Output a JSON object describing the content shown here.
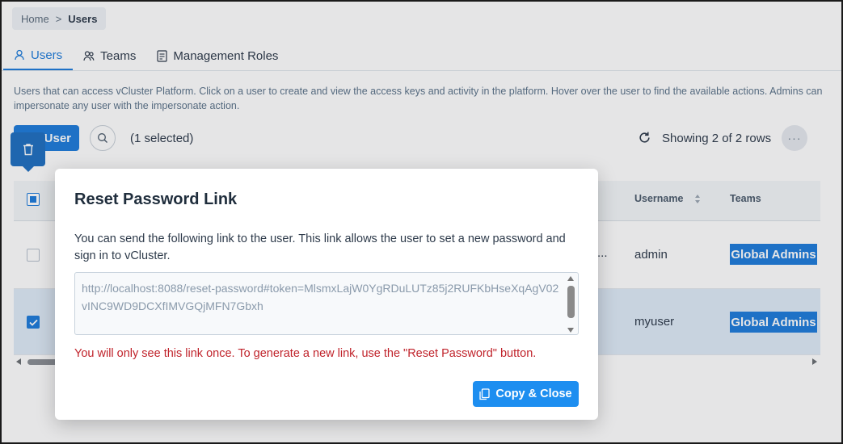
{
  "breadcrumb": {
    "home": "Home",
    "separator": ">",
    "current": "Users"
  },
  "tabs": [
    {
      "label": "Users",
      "icon": "user-icon",
      "active": true
    },
    {
      "label": "Teams",
      "icon": "teams-icon",
      "active": false
    },
    {
      "label": "Management Roles",
      "icon": "roles-icon",
      "active": false
    }
  ],
  "description": "Users that can access vCluster Platform. Click on a user to create and view the access keys and activity in the platform. Hover over the user to find the available actions. Admins can impersonate any user with the impersonate action.",
  "toolbar": {
    "add_user_label": "User",
    "selected_text": "(1 selected)",
    "showing_text": "Showing 2 of 2 rows",
    "more_label": "···"
  },
  "table": {
    "columns": {
      "username": "Username",
      "teams": "Teams"
    },
    "rows": [
      {
        "truncated": "...",
        "username": "admin",
        "team": "Global Admins",
        "checked": false
      },
      {
        "truncated": "",
        "username": "myuser",
        "team": "Global Admins",
        "checked": true
      }
    ]
  },
  "modal": {
    "title": "Reset Password Link",
    "text": "You can send the following link to the user. This link allows the user to set a new password and sign in to vCluster.",
    "link": "http://localhost:8088/reset-password#token=MlsmxLajW0YgRDuLUTz85j2RUFKbHseXqAgV02vINC9WD9DCXfIMVGQjMFN7Gbxh",
    "warning": "You will only see this link once. To generate a new link, use the \"Reset Password\" button.",
    "copy_button": "Copy & Close"
  },
  "colors": {
    "accent": "#1d7cdb",
    "warning": "#c0232b",
    "selected_row": "#deebf8"
  }
}
